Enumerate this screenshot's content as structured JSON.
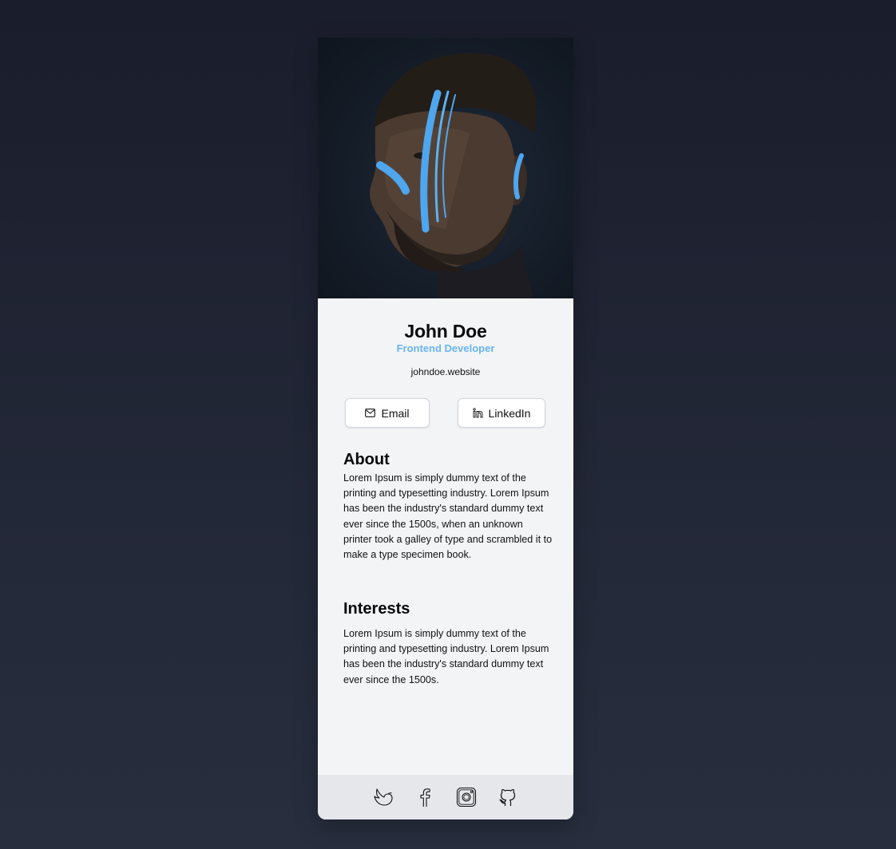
{
  "profile": {
    "name": "John Doe",
    "role": "Frontend Developer",
    "website": "johndoe.website"
  },
  "actions": {
    "email_label": "Email",
    "linkedin_label": "LinkedIn"
  },
  "about": {
    "title": "About",
    "text": "Lorem Ipsum is simply dummy text of the printing and typesetting industry. Lorem Ipsum has been the industry's standard dummy text ever since the 1500s, when an unknown printer took a galley of type and scrambled it to make a type specimen book."
  },
  "interests": {
    "title": "Interests",
    "text": "Lorem Ipsum is simply dummy text of the printing and typesetting industry. Lorem Ipsum has been the industry's standard dummy text ever since the 1500s."
  },
  "footer": {
    "icons": [
      "twitter-icon",
      "facebook-icon",
      "instagram-icon",
      "github-icon"
    ]
  },
  "colors": {
    "background": "#1f2433",
    "card": "#f3f4f6",
    "footer": "#e5e7eb",
    "accent": "#6ab4f0"
  }
}
